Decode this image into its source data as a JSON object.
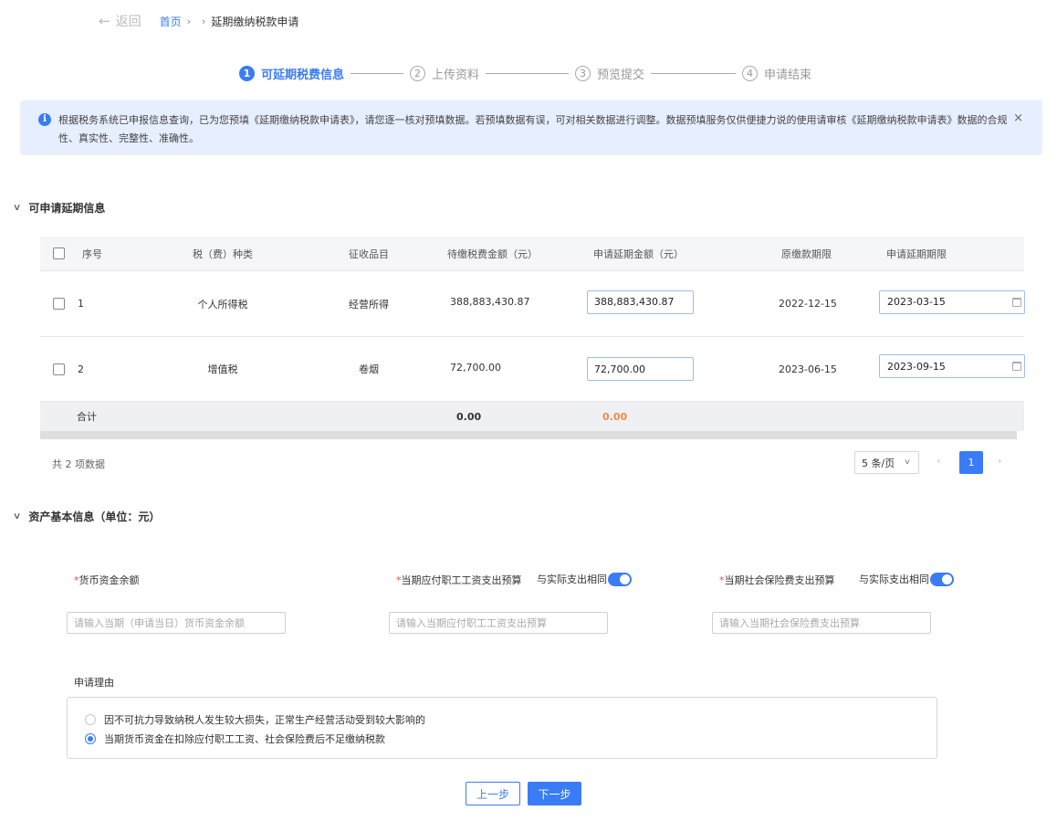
{
  "breadcrumb": {
    "back_label": "返回",
    "home_label": "首页",
    "current_label": "延期缴纳税款申请"
  },
  "steps": [
    {
      "number": "1",
      "label": "可延期税费信息",
      "active": true
    },
    {
      "number": "2",
      "label": "上传资料",
      "active": false
    },
    {
      "number": "3",
      "label": "预览提交",
      "active": false
    },
    {
      "number": "4",
      "label": "申请结束",
      "active": false
    }
  ],
  "alert": {
    "text": "根据税务系统已申报信息查询，已为您预填《延期缴纳税款申请表》，请您逐一核对预填数据。若预填数据有误，可对相关数据进行调整。数据预填服务仅供便捷力说的使用请审核《延期缴纳税款申请表》数据的合规性、真实性、完整性、准确性。",
    "close_glyph": "×"
  },
  "section1": {
    "title": "可申请延期信息"
  },
  "table": {
    "headers": {
      "index": "序号",
      "tax_type": "税（费）种类",
      "item": "征收品目",
      "amount": "待缴税费金额（元）",
      "apply_amount": "申请延期金额（元）",
      "orig_deadline": "原缴款期限",
      "apply_deadline": "申请延期期限"
    },
    "rows": [
      {
        "index": "1",
        "tax_type": "个人所得税",
        "item": "经营所得",
        "amount": "388,883,430.87",
        "apply_amount": "388,883,430.87",
        "orig_deadline": "2022-12-15",
        "apply_deadline": "2023-03-15"
      },
      {
        "index": "2",
        "tax_type": "增值税",
        "item": "卷烟",
        "amount": "72,700.00",
        "apply_amount": "72,700.00",
        "orig_deadline": "2023-06-15",
        "apply_deadline": "2023-09-15"
      }
    ],
    "summary": {
      "label": "合计",
      "amount": "0.00",
      "apply_amount": "0.00"
    }
  },
  "pagination": {
    "total_text": "共 2 项数据",
    "page_size": "5 条/页",
    "current_page": "1",
    "prev_glyph": "‹",
    "next_glyph": "›"
  },
  "section2": {
    "title": "资产基本信息（单位：元）"
  },
  "form": {
    "currency_label": "货币资金余额",
    "currency_placeholder": "请输入当期（申请当日）货币资金余额",
    "wage_label": "当期应付职工工资支出预算",
    "wage_switch_label": "与实际支出相同",
    "wage_placeholder": "请输入当期应付职工工资支出预算",
    "insurance_label": "当期社会保险费支出预算",
    "insurance_switch_label": "与实际支出相同",
    "insurance_placeholder": "请输入当期社会保险费支出预算",
    "required_mark": "*",
    "reason_label": "申请理由",
    "reasons": [
      {
        "label": "因不可抗力导致纳税人发生较大损失，正常生产经营活动受到较大影响的",
        "checked": false
      },
      {
        "label": "当期货币资金在扣除应付职工工资、社会保险费后不足缴纳税款",
        "checked": true
      }
    ]
  },
  "buttons": {
    "prev": "上一步",
    "next": "下一步"
  },
  "colors": {
    "primary": "#3a7cf5",
    "alert_bg": "#e6efff",
    "orange": "#f08a4b",
    "required": "#e74c3c"
  }
}
